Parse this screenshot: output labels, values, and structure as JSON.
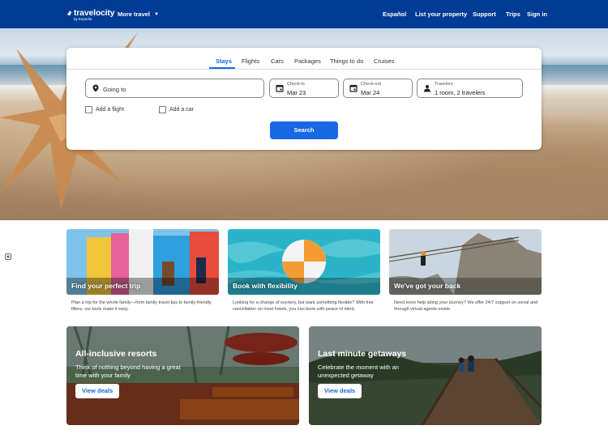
{
  "header": {
    "logo_text": "travelocity",
    "logo_subtext": "by Expedia",
    "more_travel": "More travel",
    "nav": [
      "Español",
      "List your property",
      "Support",
      "Trips",
      "Sign in"
    ],
    "background": "#003b95"
  },
  "search": {
    "tabs": [
      {
        "label": "Stays",
        "active": true
      },
      {
        "label": "Flights",
        "active": false
      },
      {
        "label": "Cars",
        "active": false
      },
      {
        "label": "Packages",
        "active": false
      },
      {
        "label": "Things to do",
        "active": false
      },
      {
        "label": "Cruises",
        "active": false
      }
    ],
    "going_to_placeholder": "Going to",
    "checkin": {
      "label": "Check-in",
      "value": "Mar 23"
    },
    "checkout": {
      "label": "Check-out",
      "value": "Mar 24"
    },
    "travelers": {
      "label": "Travelers",
      "value": "1 room, 2 travelers"
    },
    "add_flight": "Add a flight",
    "add_car": "Add a car",
    "search_button": "Search",
    "accent": "#1668e3"
  },
  "features": [
    {
      "title": "Find your perfect trip",
      "desc": "Plan a trip for the whole family—from family travel tips to family-friendly filters, our tools make it easy."
    },
    {
      "title": "Book with flexibility",
      "desc": "Looking for a change of scenery, but want something flexible? With free cancellation on most hotels, you can book with peace of mind."
    },
    {
      "title": "We've got your back",
      "desc": "Need more help along your journey? We offer 24/7 support on social and through virtual agents onsite."
    }
  ],
  "deals": [
    {
      "title": "All-inclusive resorts",
      "subtitle": "Think of nothing beyond having a great time with your family",
      "button": "View deals"
    },
    {
      "title": "Last minute getaways",
      "subtitle": "Celebrate the moment with an unexpected getaway",
      "button": "View deals"
    }
  ]
}
